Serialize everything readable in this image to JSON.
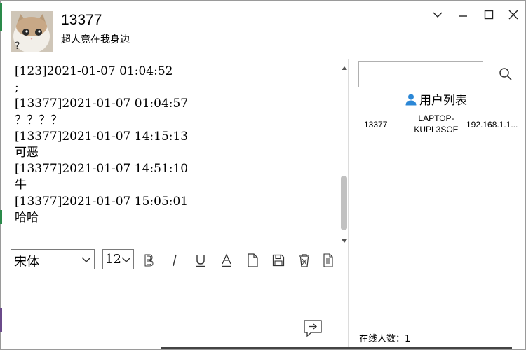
{
  "header": {
    "username": "13377",
    "signature": "超人竟在我身边",
    "avatar_icon": "cat-avatar"
  },
  "window_controls": [
    "chevron-down-icon",
    "minimize-icon",
    "maximize-icon",
    "close-icon"
  ],
  "chat": {
    "lines": [
      "[123]2021-01-07 01:04:52",
      ";",
      "[13377]2021-01-07 01:04:57",
      "？？？？",
      "[13377]2021-01-07 14:15:13",
      "可恶",
      "[13377]2021-01-07 14:51:10",
      "牛",
      "[13377]2021-01-07 15:05:01",
      "哈哈"
    ]
  },
  "toolbar": {
    "font": "宋体",
    "size": "12",
    "buttons": [
      "bold-icon",
      "italic-icon",
      "underline-icon",
      "font-color-icon",
      "file-icon",
      "save-icon",
      "clear-icon",
      "history-icon"
    ]
  },
  "input": {
    "value": ""
  },
  "sidebar": {
    "search_value": "",
    "user_list_title": "用户列表",
    "users": [
      {
        "name": "13377",
        "host": "LAPTOP-KUPL3SOE",
        "ip": "192.168.1.1..."
      }
    ],
    "online_label": "在线人数：1"
  }
}
